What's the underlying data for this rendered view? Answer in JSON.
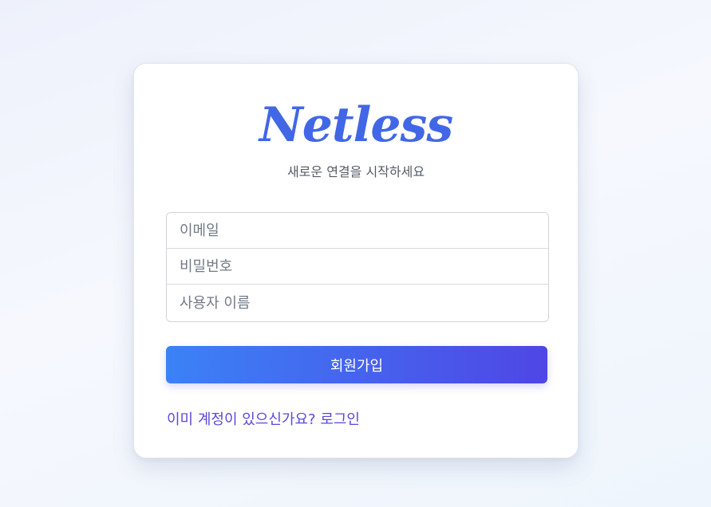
{
  "brand": {
    "logo_text": "Netless",
    "tagline": "새로운 연결을 시작하세요"
  },
  "form": {
    "email_placeholder": "이메일",
    "password_placeholder": "비밀번호",
    "username_placeholder": "사용자 이름",
    "email_value": "",
    "password_value": "",
    "username_value": "",
    "submit_label": "회원가입"
  },
  "footer": {
    "login_link": "이미 계정이 있으신가요? 로그인"
  },
  "colors": {
    "brand": "#4267e6",
    "button_gradient_start": "#3b82f6",
    "button_gradient_end": "#4f46e5",
    "link": "#5a48d8"
  }
}
